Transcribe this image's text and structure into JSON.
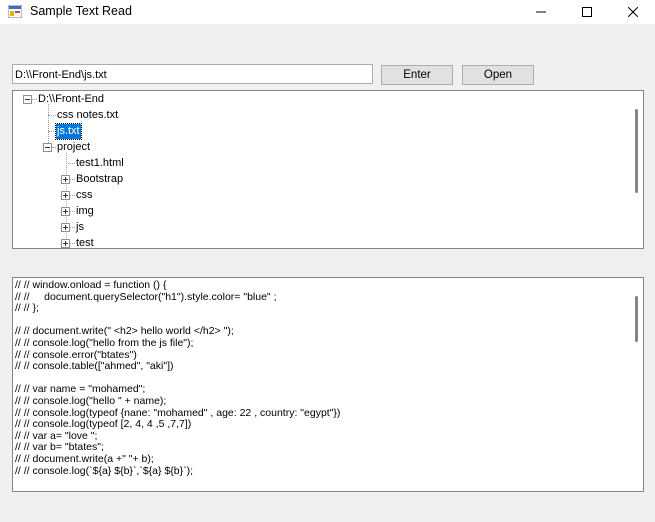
{
  "window": {
    "title": "Sample Text Read"
  },
  "toolbar": {
    "path_value": "D:\\\\Front-End\\js.txt",
    "enter_label": "Enter",
    "open_label": "Open"
  },
  "tree": {
    "root": "D:\\\\Front-End",
    "nodes": {
      "css_notes": "css notes.txt",
      "js_txt": "js.txt",
      "project": "project",
      "test1": "test1.html",
      "bootstrap": "Bootstrap",
      "css": "css",
      "img": "img",
      "js": "js",
      "test": "test"
    }
  },
  "code": {
    "lines": [
      "// // window.onload = function () {",
      "// //     document.querySelector(\"h1\").style.color= \"blue\" ;",
      "// // };",
      "",
      "// // document.write(\" <h2> hello world </h2> \");",
      "// // console.log(\"hello from the js file\");",
      "// // console.error(\"btates\")",
      "// // console.table([\"ahmed\", \"aki\"])",
      "",
      "// // var name = \"mohamed\";",
      "// // console.log(\"hello \" + name);",
      "// // console.log(typeof {nane: \"mohamed\" , age: 22 , country: \"egypt\"})",
      "// // console.log(typeof [2, 4, 4 ,5 ,7,7])",
      "// // var a= \"love \";",
      "// // var b= \"btates\";",
      "// // document.write(a +\" \"+ b);",
      "// // console.log(`${a} ${b}`,`${a} ${b}`);"
    ]
  }
}
